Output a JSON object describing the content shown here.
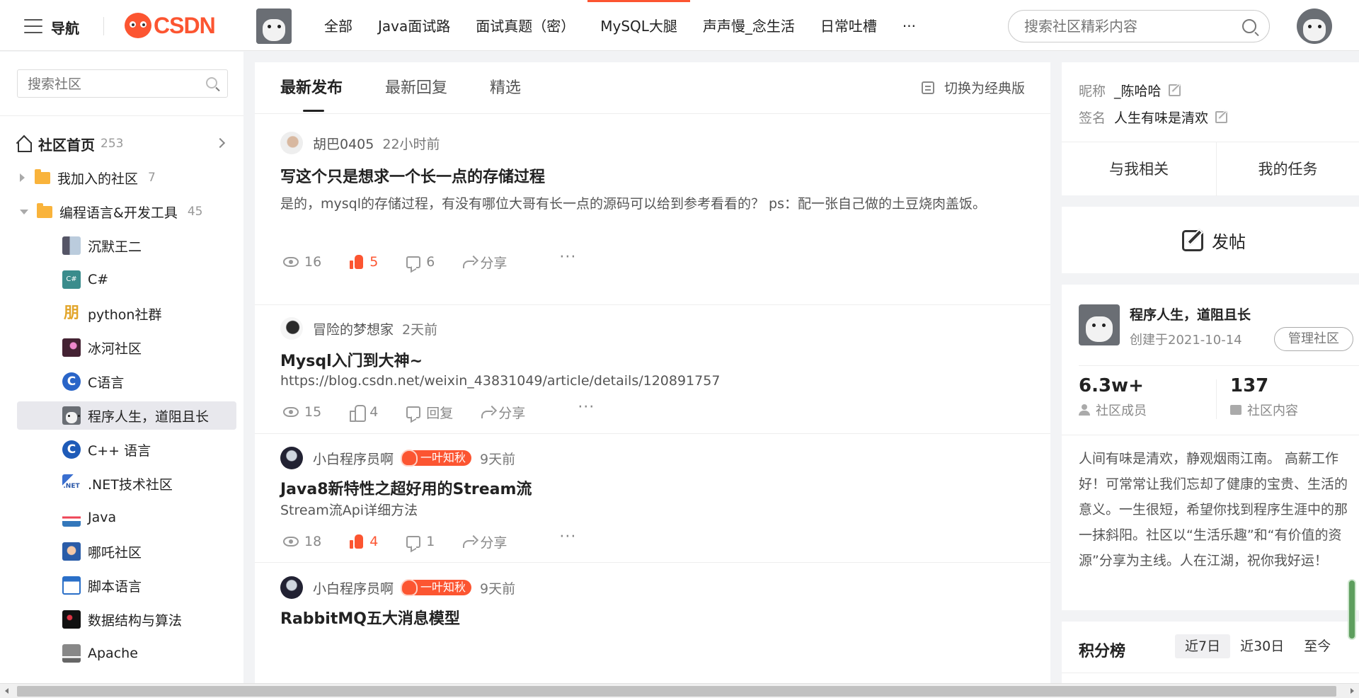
{
  "header": {
    "nav_label": "导航",
    "logo_text": "CSDN",
    "tabs": [
      {
        "label": "全部"
      },
      {
        "label": "Java面试路"
      },
      {
        "label": "面试真题（密）"
      },
      {
        "label": "MySQL大腿"
      },
      {
        "label": "声声慢_念生活"
      },
      {
        "label": "日常吐槽"
      },
      {
        "label": "···"
      }
    ],
    "active_tab": "MySQL大腿",
    "search_placeholder": "搜索社区精彩内容"
  },
  "sidebar": {
    "search_placeholder": "搜索社区",
    "home": {
      "label": "社区首页",
      "count": "253"
    },
    "groups": [
      {
        "label": "我加入的社区",
        "count": "7",
        "expanded": false
      },
      {
        "label": "编程语言&开发工具",
        "count": "45",
        "expanded": true
      }
    ],
    "communities": [
      {
        "label": "沉默王二"
      },
      {
        "label": "C#",
        "icon_text": "C#"
      },
      {
        "label": "python社群",
        "icon_text": "朋"
      },
      {
        "label": "冰河社区"
      },
      {
        "label": "C语言",
        "icon_text": "C"
      },
      {
        "label": "程序人生，道阻且长",
        "active": true
      },
      {
        "label": "C++ 语言",
        "icon_text": "C"
      },
      {
        "label": ".NET技术社区",
        "icon_text": ".NET"
      },
      {
        "label": "Java"
      },
      {
        "label": "哪吒社区"
      },
      {
        "label": "脚本语言"
      },
      {
        "label": "数据结构与算法"
      },
      {
        "label": "Apache"
      }
    ]
  },
  "feed": {
    "tabs": [
      {
        "label": "最新发布",
        "active": true
      },
      {
        "label": "最新回复"
      },
      {
        "label": "精选"
      }
    ],
    "switch_label": "切换为经典版",
    "posts": [
      {
        "author": "胡巴0405",
        "time": "22小时前",
        "title": "写这个只是想求一个长一点的存储过程",
        "body": "是的，mysql的存储过程，有没有哪位大哥有长一点的源码可以给到参考看看的？ ps：配一张自己做的土豆烧肉盖饭。",
        "views": "16",
        "likes": "5",
        "liked": true,
        "comments": "6",
        "share": "分享"
      },
      {
        "author": "冒险的梦想家",
        "time": "2天前",
        "title": "Mysql入门到大神~",
        "body": "https://blog.csdn.net/weixin_43831049/article/details/120891757",
        "views": "15",
        "likes": "4",
        "liked": false,
        "comments": "回复",
        "share": "分享"
      },
      {
        "author": "小白程序员啊",
        "badge": "一叶知秋",
        "time": "9天前",
        "title": "Java8新特性之超好用的Stream流",
        "body": "Stream流Api详细方法",
        "views": "18",
        "likes": "4",
        "liked": true,
        "comments": "1",
        "share": "分享"
      },
      {
        "author": "小白程序员啊",
        "badge": "一叶知秋",
        "time": "9天前",
        "title": "RabbitMQ五大消息模型"
      }
    ]
  },
  "profile": {
    "nickname_key": "昵称",
    "nickname": "_陈哈哈",
    "signature_key": "签名",
    "signature": "人生有味是清欢"
  },
  "mytabs": {
    "related": "与我相关",
    "tasks": "我的任务"
  },
  "post_button": "发帖",
  "community": {
    "name": "程序人生，道阻且长",
    "created": "创建于2021-10-14",
    "manage": "管理社区",
    "members_num": "6.3w+",
    "members_label": "社区成员",
    "content_num": "137",
    "content_label": "社区内容",
    "description": "人间有味是清欢，静观烟雨江南。 高薪工作好！可常常让我们忘却了健康的宝贵、生活的意义。一生很短，希望你找到程序生涯中的那一抹斜阳。社区以“生活乐趣”和“有价值的资源”分享为主线。人在江湖，祝你我好运！"
  },
  "rank": {
    "title": "积分榜",
    "tabs": [
      {
        "label": "近7日",
        "active": true
      },
      {
        "label": "近30日"
      },
      {
        "label": "至今"
      }
    ]
  },
  "colors": {
    "accent": "#fc5531",
    "folder": "#f9b33b"
  }
}
